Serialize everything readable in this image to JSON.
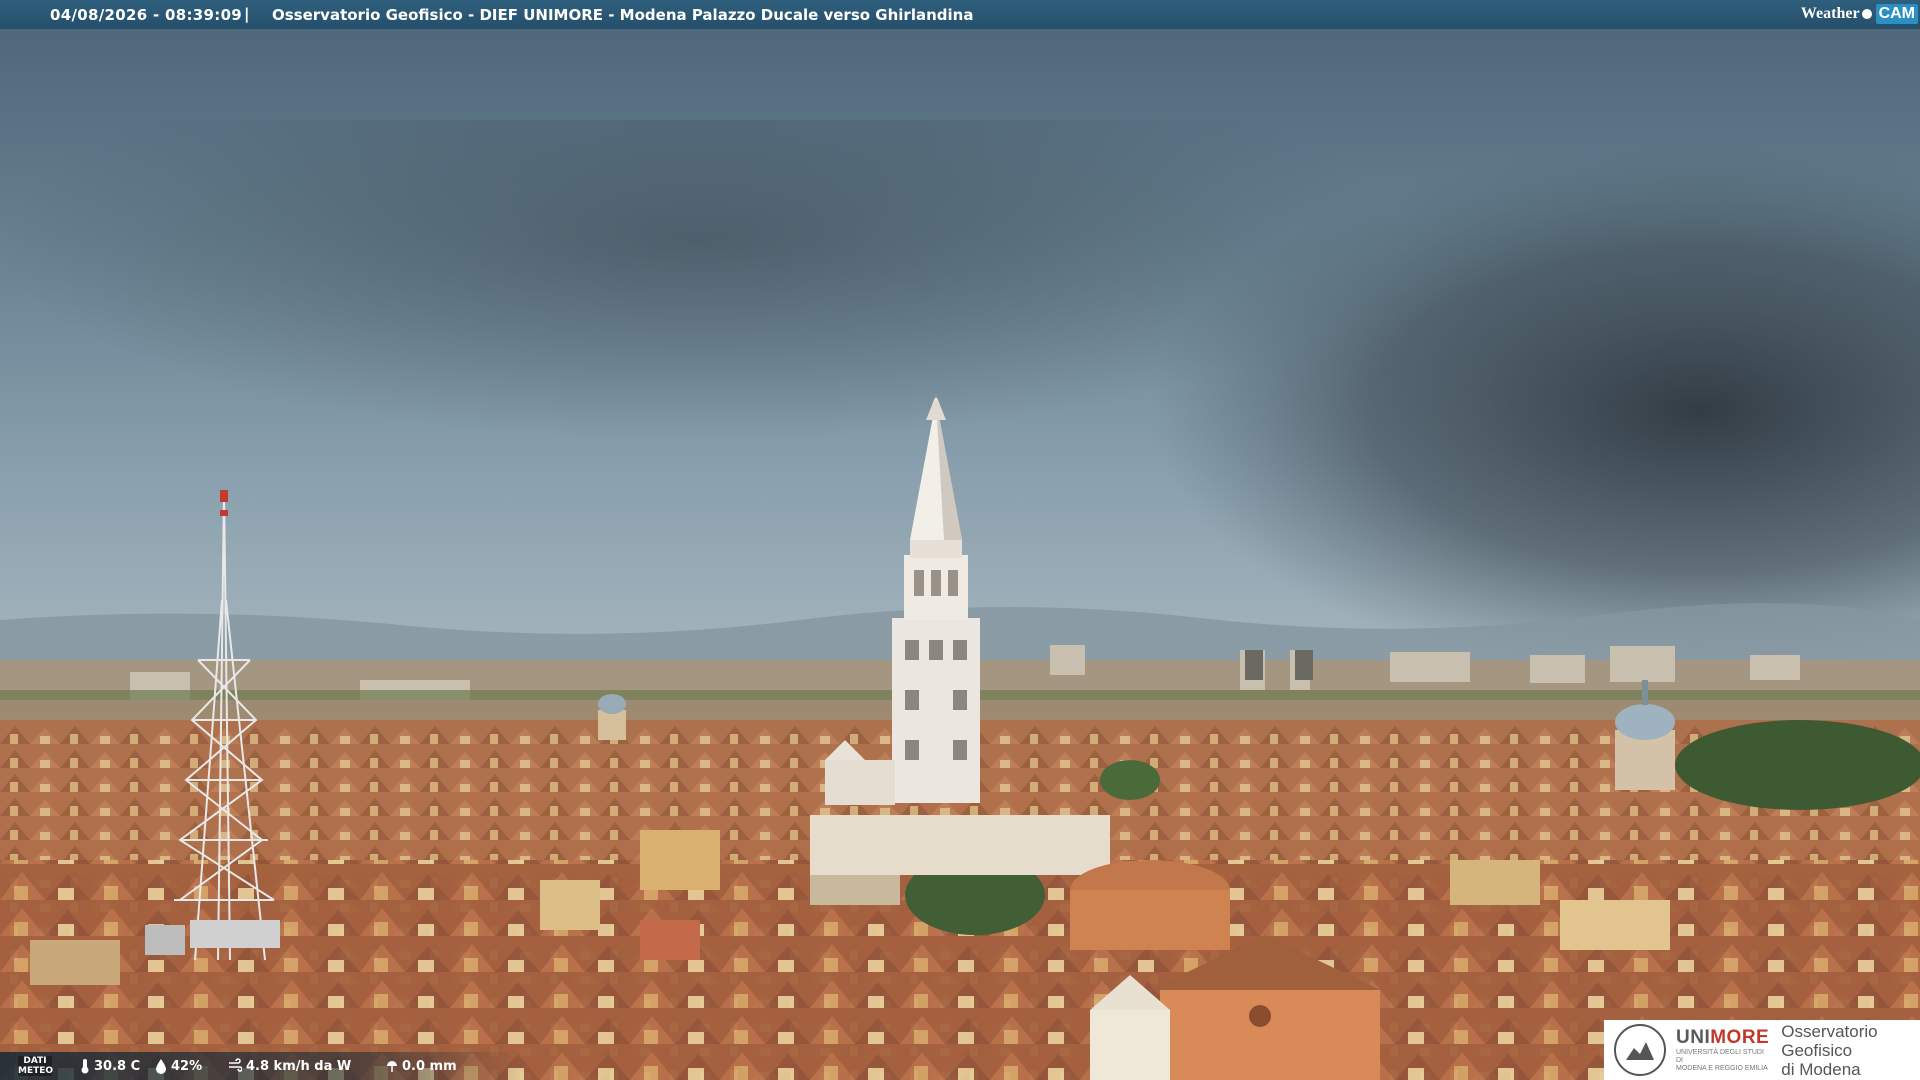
{
  "overlay": {
    "timestamp": "04/08/2026 - 08:39:09",
    "separator": "|",
    "title": "Osservatorio Geofisico - DIEF UNIMORE - Modena Palazzo Ducale verso Ghirlandina",
    "brand_weather": "Weather",
    "brand_cam": "CAM"
  },
  "weather": {
    "label_line1": "DATI",
    "label_line2": "METEO",
    "temperature": "30.8 C",
    "humidity": "42%",
    "wind": "4.8 km/h da W",
    "rain": "0.0 mm"
  },
  "logo": {
    "brand_prefix": "UNI",
    "brand_suffix": "MORE",
    "university_line1": "UNIVERSITÀ DEGLI STUDI DI",
    "university_line2": "MODENA E REGGIO EMILIA",
    "observatory_line1": "Osservatorio Geofisico",
    "observatory_line2": "di Modena"
  },
  "colors": {
    "sky_top": "#4a6275",
    "sky_mid": "#7d95a8",
    "cloud_dark": "#3b4650",
    "roof": "#b0714c",
    "tower": "#ece8e2",
    "bar": "#2a5572",
    "accent_red": "#c0392b"
  }
}
